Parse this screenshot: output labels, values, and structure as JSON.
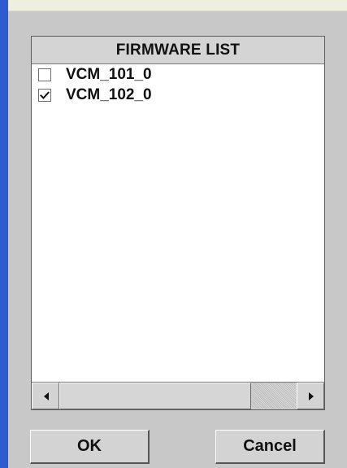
{
  "dialog": {
    "firmware_list": {
      "header": "FIRMWARE LIST",
      "items": [
        {
          "label": "VCM_101_0",
          "checked": false
        },
        {
          "label": "VCM_102_0",
          "checked": true
        }
      ],
      "horizontal_scroll": {
        "left_arrow_icon": "triangle-left-icon",
        "right_arrow_icon": "triangle-right-icon",
        "thumb_position": "left"
      }
    },
    "buttons": {
      "ok": "OK",
      "cancel": "Cancel"
    }
  },
  "colors": {
    "dialog_background": "#c8c8c8",
    "list_background": "#ffffff",
    "header_background": "#d4d4d4",
    "left_accent": "#2f5bd1",
    "top_strip": "#efefdf"
  }
}
